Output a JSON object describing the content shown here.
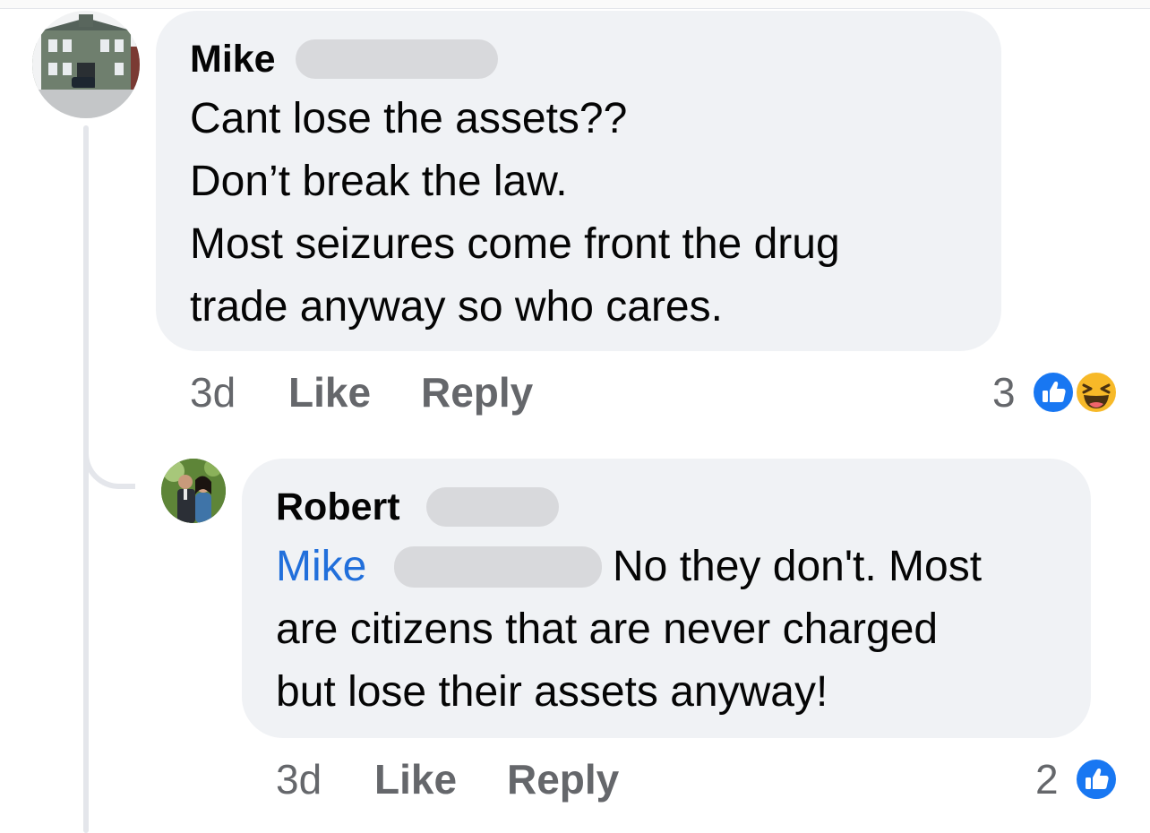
{
  "comments": [
    {
      "author": "Mike",
      "lines": [
        "Cant lose the assets??",
        "Don’t break the law.",
        "Most seizures come front the drug",
        "trade anyway so who cares."
      ],
      "time": "3d",
      "like_label": "Like",
      "reply_label": "Reply",
      "reaction_count": "3",
      "reactions": [
        "like-icon",
        "haha-icon"
      ]
    },
    {
      "author": "Robert",
      "mention": "Mike",
      "lines": [
        "No they don't. Most",
        "are citizens that are never charged",
        "but lose their assets anyway!"
      ],
      "time": "3d",
      "like_label": "Like",
      "reply_label": "Reply",
      "reaction_count": "2",
      "reactions": [
        "like-icon"
      ]
    }
  ],
  "colors": {
    "bubble": "#f0f2f5",
    "mention": "#216fdb",
    "like_blue": "#1877f2",
    "haha_yellow": "#f7b928",
    "meta_gray": "#65676b"
  }
}
